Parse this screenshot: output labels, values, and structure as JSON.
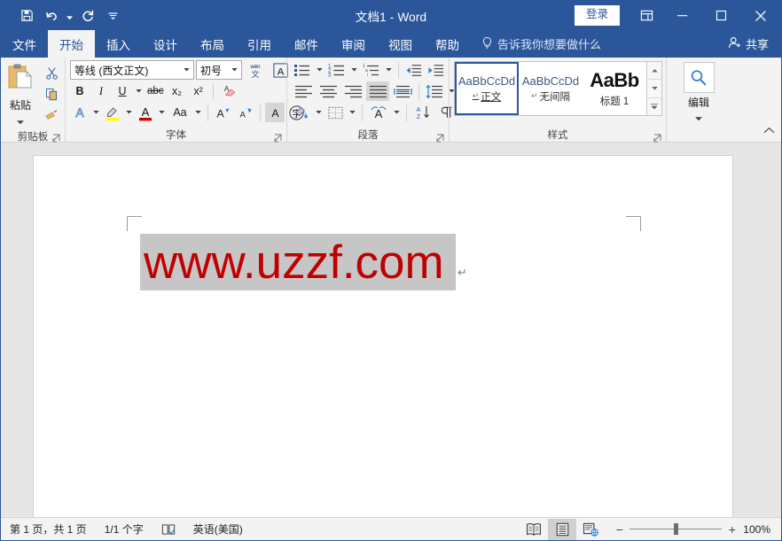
{
  "window": {
    "title": "文档1  -  Word",
    "signin_label": "登录",
    "minimize": "minimize",
    "maximize": "maximize",
    "close": "close"
  },
  "qat": {
    "save": "save-icon",
    "undo": "undo-icon",
    "redo": "redo-icon",
    "customize": "customize-qat-icon"
  },
  "tabs": [
    {
      "label": "文件",
      "active": false
    },
    {
      "label": "开始",
      "active": true
    },
    {
      "label": "插入",
      "active": false
    },
    {
      "label": "设计",
      "active": false
    },
    {
      "label": "布局",
      "active": false
    },
    {
      "label": "引用",
      "active": false
    },
    {
      "label": "邮件",
      "active": false
    },
    {
      "label": "审阅",
      "active": false
    },
    {
      "label": "视图",
      "active": false
    },
    {
      "label": "帮助",
      "active": false
    }
  ],
  "tell_me": "告诉我你想要做什么",
  "share": "共享",
  "ribbon": {
    "clipboard": {
      "group_label": "剪贴板",
      "paste_label": "粘贴",
      "cut": "scissors-icon",
      "copy": "copy-icon",
      "format_painter": "format-painter-icon"
    },
    "font": {
      "group_label": "字体",
      "font_name": "等线 (西文正文)",
      "font_size": "初号",
      "phonetic_guide": "wén",
      "character_border": "A",
      "bold": "B",
      "italic": "I",
      "underline": "U",
      "strikethrough": "abc",
      "subscript": "x₂",
      "superscript": "x²",
      "clear_formatting": "clear-formatting-icon",
      "text_effects": "A",
      "highlight_color": "#ffff00",
      "font_color": "#cc0000",
      "change_case": "Aa",
      "grow_font": "A",
      "shrink_font": "A",
      "character_shading": "A",
      "enclose_characters": "字"
    },
    "paragraph": {
      "group_label": "段落",
      "bullets": "bullets-icon",
      "numbering": "numbering-icon",
      "multilevel": "multilevel-list-icon",
      "decrease_indent": "decrease-indent-icon",
      "increase_indent": "increase-indent-icon",
      "align_left": "align-left-icon",
      "align_center": "align-center-icon",
      "align_right": "align-right-icon",
      "justify": "justify-icon",
      "distribute": "distribute-icon",
      "line_spacing": "line-spacing-icon",
      "shading": "shading-icon",
      "borders": "borders-icon",
      "asian_layout": "asian-layout-icon",
      "sort": "sort-icon",
      "show_marks": "show-paragraph-marks-icon"
    },
    "styles": {
      "group_label": "样式",
      "items": [
        {
          "preview": "AaBbCcDd",
          "name": "正文",
          "selected": true
        },
        {
          "preview": "AaBbCcDd",
          "name": "无间隔",
          "selected": false
        },
        {
          "preview": "AaBb",
          "name": "标题 1",
          "selected": false
        }
      ]
    },
    "editing": {
      "group_label": "编辑",
      "icon": "search-icon"
    },
    "collapse": "collapse-ribbon-icon"
  },
  "document": {
    "text": "www.uzzf.com",
    "text_color": "#c00000",
    "paragraph_mark": "↵",
    "selected": true
  },
  "statusbar": {
    "page_info": "第 1 页，共 1 页",
    "word_count": "1/1 个字",
    "proofing": "proofing-icon",
    "language": "英语(美国)",
    "views": [
      {
        "name": "read-mode",
        "active": false
      },
      {
        "name": "print-layout",
        "active": true
      },
      {
        "name": "web-layout",
        "active": false
      }
    ],
    "zoom_out": "−",
    "zoom_in": "+",
    "zoom_level": "100%"
  }
}
